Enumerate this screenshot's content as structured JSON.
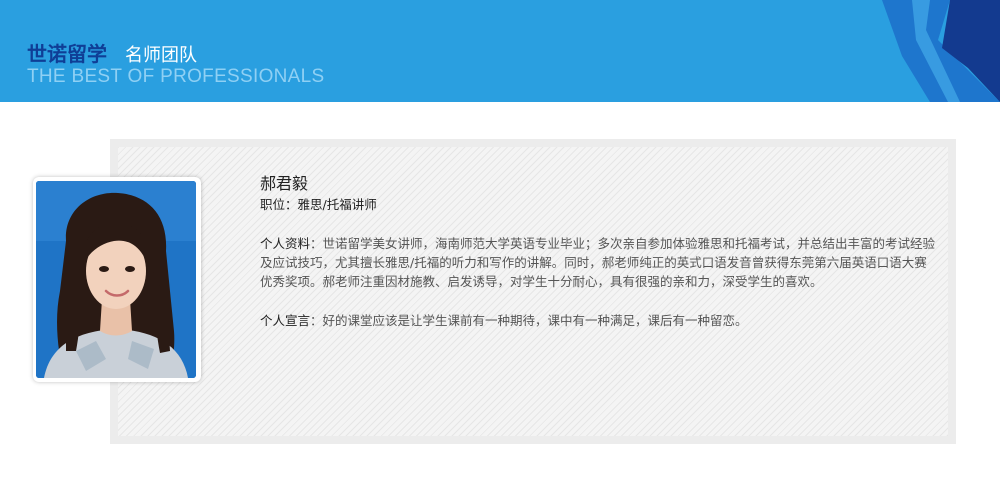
{
  "header": {
    "brand_logo": "世诺留学",
    "section_title": "名师团队",
    "subtitle": "THE BEST OF PROFESSIONALS",
    "colors": {
      "band": "#2a9fe0",
      "logo": "#0f3e96",
      "corner_dark": "#133a8f",
      "corner_mid": "#1e76cd"
    }
  },
  "teacher": {
    "name": "郝君毅",
    "position_label": "职位：",
    "position_value": "雅思/托福讲师",
    "profile_label": "个人资料",
    "profile_text": "：世诺留学美女讲师，海南师范大学英语专业毕业；多次亲自参加体验雅思和托福考试，并总结出丰富的考试经验及应试技巧，尤其擅长雅思/托福的听力和写作的讲解。同时，郝老师纯正的英式口语发音曾获得东莞第六届英语口语大赛优秀奖项。郝老师注重因材施教、启发诱导，对学生十分耐心，具有很强的亲和力，深受学生的喜欢。",
    "motto_label": "个人宣言",
    "motto_text": "：好的课堂应该是让学生课前有一种期待，课中有一种满足，课后有一种留恋。"
  }
}
